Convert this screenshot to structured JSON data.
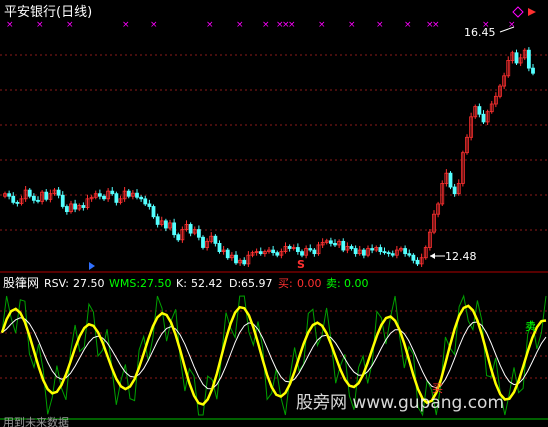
{
  "header": {
    "title": "平安银行(日线)"
  },
  "price_panel": {
    "high_label": "16.45",
    "low_label": "12.48",
    "signal_marker": "S"
  },
  "indicator_panel": {
    "name": "股箻网",
    "items": [
      {
        "label": "RSV:",
        "value": "27.50",
        "color": "#ffffff"
      },
      {
        "label": "WMS:",
        "value": "27.50",
        "color": "#00ff00"
      },
      {
        "label": "K:",
        "value": "52.42",
        "color": "#ffffff"
      },
      {
        "label": "D:",
        "value": "65.97",
        "color": "#ffffff"
      },
      {
        "label": "买:",
        "value": "0.00",
        "color": "#ff3030"
      },
      {
        "label": "卖:",
        "value": "0.00",
        "color": "#00ff00"
      }
    ],
    "buy_tag": "买",
    "sell_tag": "卖",
    "footer_text": "用到未来数据"
  },
  "watermark": {
    "text": "股旁网 www.gupang.com"
  },
  "colors": {
    "background": "#000000",
    "grid": "#8b1a1a",
    "up_candle": "#ff3030",
    "down_candle": "#54ffff",
    "k_line": "#ffff00",
    "d_line": "#ffffff",
    "wms_line": "#00a000",
    "marker": "#ff00ff",
    "divider": "#b00000"
  },
  "chart_data": [
    {
      "type": "candlestick",
      "title": "平安银行(日线)",
      "y_high": 16.45,
      "y_low": 12.48,
      "ylim": [
        12.1,
        16.9
      ],
      "close": [
        13.55,
        13.5,
        13.38,
        13.36,
        13.45,
        13.62,
        13.5,
        13.42,
        13.4,
        13.58,
        13.44,
        13.55,
        13.62,
        13.52,
        13.3,
        13.2,
        13.35,
        13.25,
        13.32,
        13.28,
        13.45,
        13.48,
        13.55,
        13.5,
        13.45,
        13.6,
        13.55,
        13.38,
        13.45,
        13.6,
        13.5,
        13.56,
        13.48,
        13.45,
        13.35,
        13.3,
        13.1,
        12.95,
        13.02,
        12.88,
        12.98,
        12.75,
        12.65,
        12.85,
        12.95,
        12.78,
        12.85,
        12.7,
        12.5,
        12.62,
        12.72,
        12.58,
        12.42,
        12.45,
        12.3,
        12.35,
        12.2,
        12.25,
        12.18,
        12.35,
        12.4,
        12.42,
        12.38,
        12.42,
        12.45,
        12.4,
        12.35,
        12.42,
        12.52,
        12.48,
        12.5,
        12.42,
        12.35,
        12.48,
        12.45,
        12.38,
        12.55,
        12.6,
        12.63,
        12.58,
        12.55,
        12.62,
        12.45,
        12.52,
        12.48,
        12.38,
        12.45,
        12.35,
        12.48,
        12.45,
        12.5,
        12.42,
        12.4,
        12.38,
        12.35,
        12.45,
        12.48,
        12.38,
        12.35,
        12.25,
        12.18,
        12.3,
        12.5,
        12.8,
        13.15,
        13.35,
        13.75,
        13.95,
        13.68,
        13.55,
        13.75,
        14.35,
        14.65,
        15.05,
        15.25,
        15.1,
        14.95,
        15.15,
        15.3,
        15.45,
        15.65,
        15.85,
        16.15,
        16.3,
        16.1,
        16.2,
        16.35,
        16.0,
        15.9
      ]
    },
    {
      "type": "line",
      "title": "股箻网",
      "ylim": [
        0,
        100
      ],
      "series": [
        {
          "name": "RSV",
          "value": 27.5
        },
        {
          "name": "WMS",
          "value": 27.5
        },
        {
          "name": "K",
          "value": 52.42
        },
        {
          "name": "D",
          "value": 65.97
        },
        {
          "name": "买",
          "value": 0.0
        },
        {
          "name": "卖",
          "value": 0.0
        }
      ]
    }
  ]
}
